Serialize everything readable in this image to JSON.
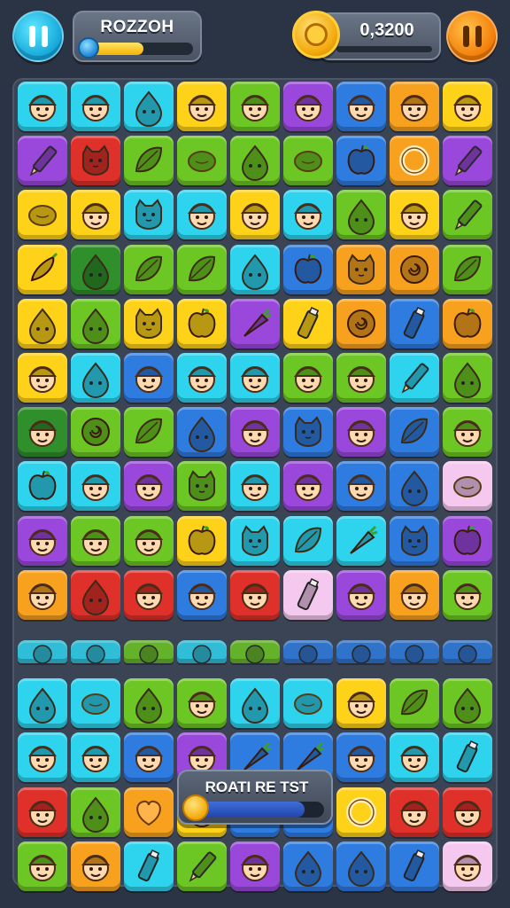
{
  "header": {
    "menu_icon": "pause-icon",
    "player_name": "ROZZOH",
    "name_progress": 0.55,
    "coin_icon": "coin-icon",
    "score": "0,3200",
    "pause_icon": "pause-icon"
  },
  "popup": {
    "text": "ROATI RE TST",
    "progress": 0.85
  },
  "colors": {
    "cyan": "#2ed3ee",
    "yellow": "#ffd21a",
    "green": "#6cc623",
    "purple": "#9a47db",
    "red": "#e0302a",
    "orange": "#f7a11f",
    "blue": "#2f7ce0",
    "pink": "#f5c8ef",
    "darkgreen": "#2f8f2a"
  },
  "board": {
    "rows": [
      [
        [
          "cyan",
          "face"
        ],
        [
          "cyan",
          "face"
        ],
        [
          "cyan",
          "drop"
        ],
        [
          "yellow",
          "face"
        ],
        [
          "green",
          "face"
        ],
        [
          "purple",
          "face"
        ],
        [
          "blue",
          "face"
        ],
        [
          "orange",
          "face"
        ],
        [
          "yellow",
          "face"
        ]
      ],
      [
        [
          "purple",
          "pencil"
        ],
        [
          "red",
          "cat"
        ],
        [
          "green",
          "leaf"
        ],
        [
          "green",
          "lemon"
        ],
        [
          "green",
          "drop"
        ],
        [
          "green",
          "lemon"
        ],
        [
          "blue",
          "apple"
        ],
        [
          "orange",
          "ring"
        ],
        [
          "purple",
          "pencil"
        ]
      ],
      [
        [
          "yellow",
          "lemon"
        ],
        [
          "yellow",
          "face"
        ],
        [
          "cyan",
          "cat"
        ],
        [
          "cyan",
          "face"
        ],
        [
          "yellow",
          "face"
        ],
        [
          "cyan",
          "face"
        ],
        [
          "green",
          "drop"
        ],
        [
          "yellow",
          "face"
        ],
        [
          "green",
          "pencil"
        ]
      ],
      [
        [
          "yellow",
          "pepper"
        ],
        [
          "darkgreen",
          "drop"
        ],
        [
          "green",
          "leaf"
        ],
        [
          "green",
          "leaf"
        ],
        [
          "cyan",
          "drop"
        ],
        [
          "blue",
          "apple"
        ],
        [
          "orange",
          "cat"
        ],
        [
          "orange",
          "swirl"
        ],
        [
          "green",
          "leaf"
        ]
      ],
      [
        [
          "yellow",
          "drop"
        ],
        [
          "green",
          "drop"
        ],
        [
          "yellow",
          "cat"
        ],
        [
          "yellow",
          "apple"
        ],
        [
          "purple",
          "carrot"
        ],
        [
          "yellow",
          "bottle"
        ],
        [
          "orange",
          "swirl"
        ],
        [
          "blue",
          "bottle"
        ],
        [
          "orange",
          "apple"
        ]
      ],
      [
        [
          "yellow",
          "face"
        ],
        [
          "cyan",
          "drop"
        ],
        [
          "blue",
          "face"
        ],
        [
          "cyan",
          "face"
        ],
        [
          "cyan",
          "face"
        ],
        [
          "green",
          "face"
        ],
        [
          "green",
          "face"
        ],
        [
          "cyan",
          "pencil"
        ],
        [
          "green",
          "drop"
        ]
      ],
      [
        [
          "darkgreen",
          "face"
        ],
        [
          "green",
          "swirl"
        ],
        [
          "green",
          "leaf"
        ],
        [
          "blue",
          "drop"
        ],
        [
          "purple",
          "face"
        ],
        [
          "blue",
          "cat"
        ],
        [
          "purple",
          "face"
        ],
        [
          "blue",
          "leaf"
        ],
        [
          "green",
          "face"
        ]
      ],
      [
        [
          "cyan",
          "apple"
        ],
        [
          "cyan",
          "face"
        ],
        [
          "purple",
          "face"
        ],
        [
          "green",
          "cat"
        ],
        [
          "cyan",
          "face"
        ],
        [
          "purple",
          "face"
        ],
        [
          "blue",
          "face"
        ],
        [
          "blue",
          "drop"
        ],
        [
          "pink",
          "lemon"
        ]
      ],
      [
        [
          "purple",
          "face"
        ],
        [
          "green",
          "face"
        ],
        [
          "green",
          "face"
        ],
        [
          "yellow",
          "apple"
        ],
        [
          "cyan",
          "cat"
        ],
        [
          "cyan",
          "leaf"
        ],
        [
          "cyan",
          "carrot"
        ],
        [
          "blue",
          "cat"
        ],
        [
          "purple",
          "apple"
        ]
      ],
      [
        [
          "orange",
          "face"
        ],
        [
          "red",
          "drop"
        ],
        [
          "red",
          "face"
        ],
        [
          "blue",
          "face"
        ],
        [
          "red",
          "face"
        ],
        [
          "pink",
          "bottle"
        ],
        [
          "purple",
          "face"
        ],
        [
          "orange",
          "face"
        ],
        [
          "green",
          "face"
        ]
      ],
      [
        [
          "cyan",
          "apple"
        ],
        [
          "cyan",
          "drop"
        ],
        [
          "green",
          "drop"
        ],
        [
          "cyan",
          "drop"
        ],
        [
          "green",
          "drop"
        ],
        [
          "blue",
          "drop"
        ],
        [
          "blue",
          "drop"
        ],
        [
          "blue",
          "drop"
        ],
        [
          "blue",
          "drop"
        ]
      ],
      [
        [
          "cyan",
          "drop"
        ],
        [
          "cyan",
          "lemon"
        ],
        [
          "green",
          "drop"
        ],
        [
          "green",
          "face"
        ],
        [
          "cyan",
          "drop"
        ],
        [
          "cyan",
          "lemon"
        ],
        [
          "yellow",
          "face"
        ],
        [
          "green",
          "leaf"
        ],
        [
          "green",
          "drop"
        ]
      ],
      [
        [
          "cyan",
          "face"
        ],
        [
          "cyan",
          "face"
        ],
        [
          "blue",
          "face"
        ],
        [
          "purple",
          "face"
        ],
        [
          "blue",
          "carrot"
        ],
        [
          "blue",
          "carrot"
        ],
        [
          "blue",
          "face"
        ],
        [
          "cyan",
          "face"
        ],
        [
          "cyan",
          "bottle"
        ]
      ],
      [
        [
          "red",
          "face"
        ],
        [
          "green",
          "drop"
        ],
        [
          "orange",
          "heart"
        ],
        [
          "yellow",
          "face"
        ],
        [
          "blue",
          "empty"
        ],
        [
          "blue",
          "empty"
        ],
        [
          "yellow",
          "ring"
        ],
        [
          "red",
          "face"
        ],
        [
          "red",
          "face"
        ]
      ],
      [
        [
          "green",
          "face"
        ],
        [
          "orange",
          "face"
        ],
        [
          "cyan",
          "bottle"
        ],
        [
          "green",
          "pencil"
        ],
        [
          "purple",
          "face"
        ],
        [
          "blue",
          "drop"
        ],
        [
          "blue",
          "drop"
        ],
        [
          "blue",
          "bottle"
        ],
        [
          "pink",
          "face"
        ]
      ]
    ]
  }
}
